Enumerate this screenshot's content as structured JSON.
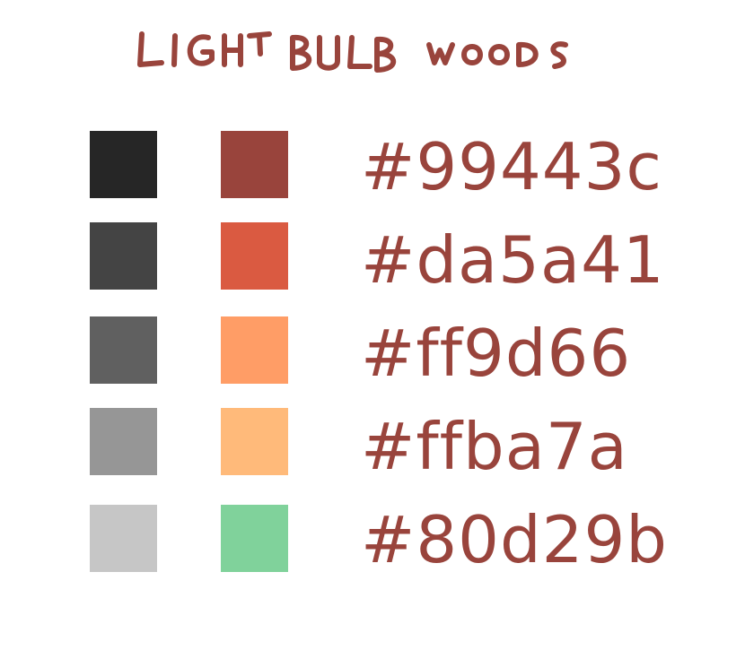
{
  "title": "LIGHT BULB WOODS",
  "text_color": "#99443c",
  "grays": [
    {
      "color": "#262626"
    },
    {
      "color": "#444444"
    },
    {
      "color": "#606060"
    },
    {
      "color": "#969696"
    },
    {
      "color": "#c6c6c6"
    }
  ],
  "colors": [
    {
      "color": "#99443c",
      "hex": "#99443c"
    },
    {
      "color": "#da5a41",
      "hex": "#da5a41"
    },
    {
      "color": "#ff9d66",
      "hex": "#ff9d66"
    },
    {
      "color": "#ffba7a",
      "hex": "#ffba7a"
    },
    {
      "color": "#80d29b",
      "hex": "#80d29b"
    }
  ]
}
